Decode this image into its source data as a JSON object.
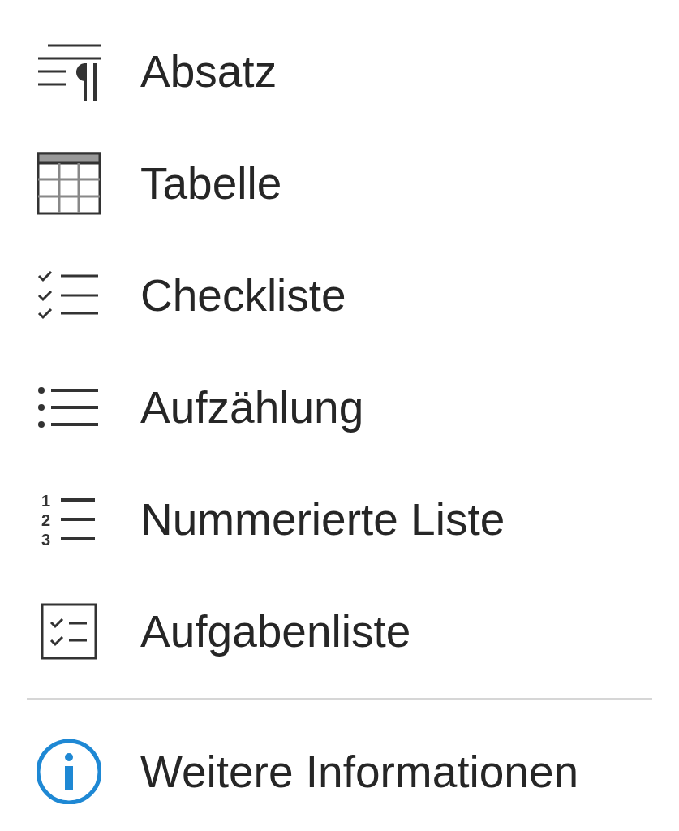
{
  "menu": {
    "sections": [
      {
        "items": [
          {
            "kind": "paragraph",
            "label": "Absatz"
          },
          {
            "kind": "table",
            "label": "Tabelle"
          },
          {
            "kind": "checklist",
            "label": "Checkliste"
          },
          {
            "kind": "bullets",
            "label": "Aufzählung"
          },
          {
            "kind": "numbered",
            "label": "Nummerierte Liste",
            "icon_digits": [
              "1",
              "2",
              "3"
            ]
          },
          {
            "kind": "tasks",
            "label": "Aufgabenliste"
          }
        ]
      },
      {
        "items": [
          {
            "kind": "info",
            "label": "Weitere Informationen"
          }
        ]
      }
    ]
  }
}
